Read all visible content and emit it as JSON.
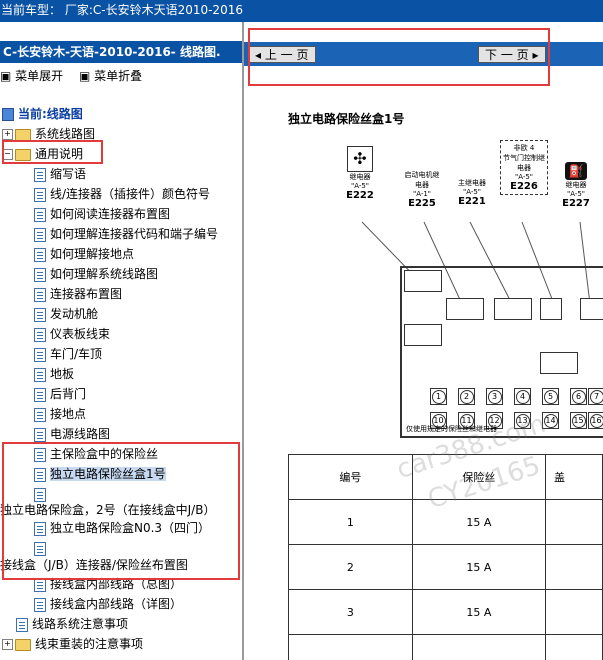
{
  "window_title": "当前车型：  厂家:C-长安铃木天语2010-2016",
  "left_panel": {
    "title": "C-长安铃木-天语-2010-2016- 线路图.",
    "expand_label": "菜单展开",
    "collapse_label": "菜单折叠",
    "current_label": "当前:线路图"
  },
  "tree": [
    {
      "label": "系统线路图"
    },
    {
      "label": "通用说明"
    },
    {
      "label": "缩写语"
    },
    {
      "label": "线/连接器（插接件）颜色符号"
    },
    {
      "label": "如何阅读连接器布置图"
    },
    {
      "label": "如何理解连接器代码和端子编号"
    },
    {
      "label": "如何理解接地点"
    },
    {
      "label": "如何理解系统线路图"
    },
    {
      "label": "连接器布置图"
    },
    {
      "label": "发动机舱"
    },
    {
      "label": "仪表板线束"
    },
    {
      "label": "车门/车顶"
    },
    {
      "label": "地板"
    },
    {
      "label": "后背门"
    },
    {
      "label": "接地点"
    },
    {
      "label": "电源线路图"
    },
    {
      "label": "主保险盒中的保险丝"
    },
    {
      "label": "独立电路保险丝盒1号"
    },
    {
      "label": ""
    },
    {
      "label": "独立电路保险盒，2号（在接线盒中J/B）"
    },
    {
      "label": "独立电路保险盒N0.3（四门）"
    },
    {
      "label": ""
    },
    {
      "label": "接线盒（J/B）连接器/保险丝布置图"
    },
    {
      "label": "接线盒内部线路（总图）"
    },
    {
      "label": "接线盒内部线路（详图）"
    },
    {
      "label": "线路系统注意事项"
    },
    {
      "label": "线束重装的注意事项"
    }
  ],
  "nav": {
    "prev": "上 一 页",
    "next": "下 一 页"
  },
  "doc": {
    "title": "独立电路保险丝盒1号",
    "relays": [
      {
        "name": "继电器",
        "pin": "\"A-5\"",
        "code": "E222"
      },
      {
        "name": "启动电机继电器",
        "pin": "\"A-1\"",
        "code": "E225"
      },
      {
        "name": "主继电器",
        "pin": "\"A-5\"",
        "code": "E221"
      },
      {
        "name": "节气门控制继电器",
        "note": "非欧 4",
        "pin": "\"A-5\"",
        "code": "E226"
      },
      {
        "name": "继电器",
        "pin": "\"A-5\"",
        "code": "E227"
      }
    ],
    "fuse_numbers_row1": [
      "1",
      "2",
      "3",
      "4",
      "5",
      "6",
      "7"
    ],
    "fuse_numbers_row2": [
      "10",
      "11",
      "12",
      "13",
      "14",
      "15",
      "16"
    ],
    "box_note": "仅使用规定的保险丝和继电器",
    "table_headers": [
      "编号",
      "保险丝",
      "盖"
    ],
    "table_rows": [
      {
        "no": "1",
        "fuse": "15 A"
      },
      {
        "no": "2",
        "fuse": "15 A"
      },
      {
        "no": "3",
        "fuse": "15 A"
      }
    ],
    "watermarks": [
      "car388.com",
      "CY20165"
    ]
  }
}
